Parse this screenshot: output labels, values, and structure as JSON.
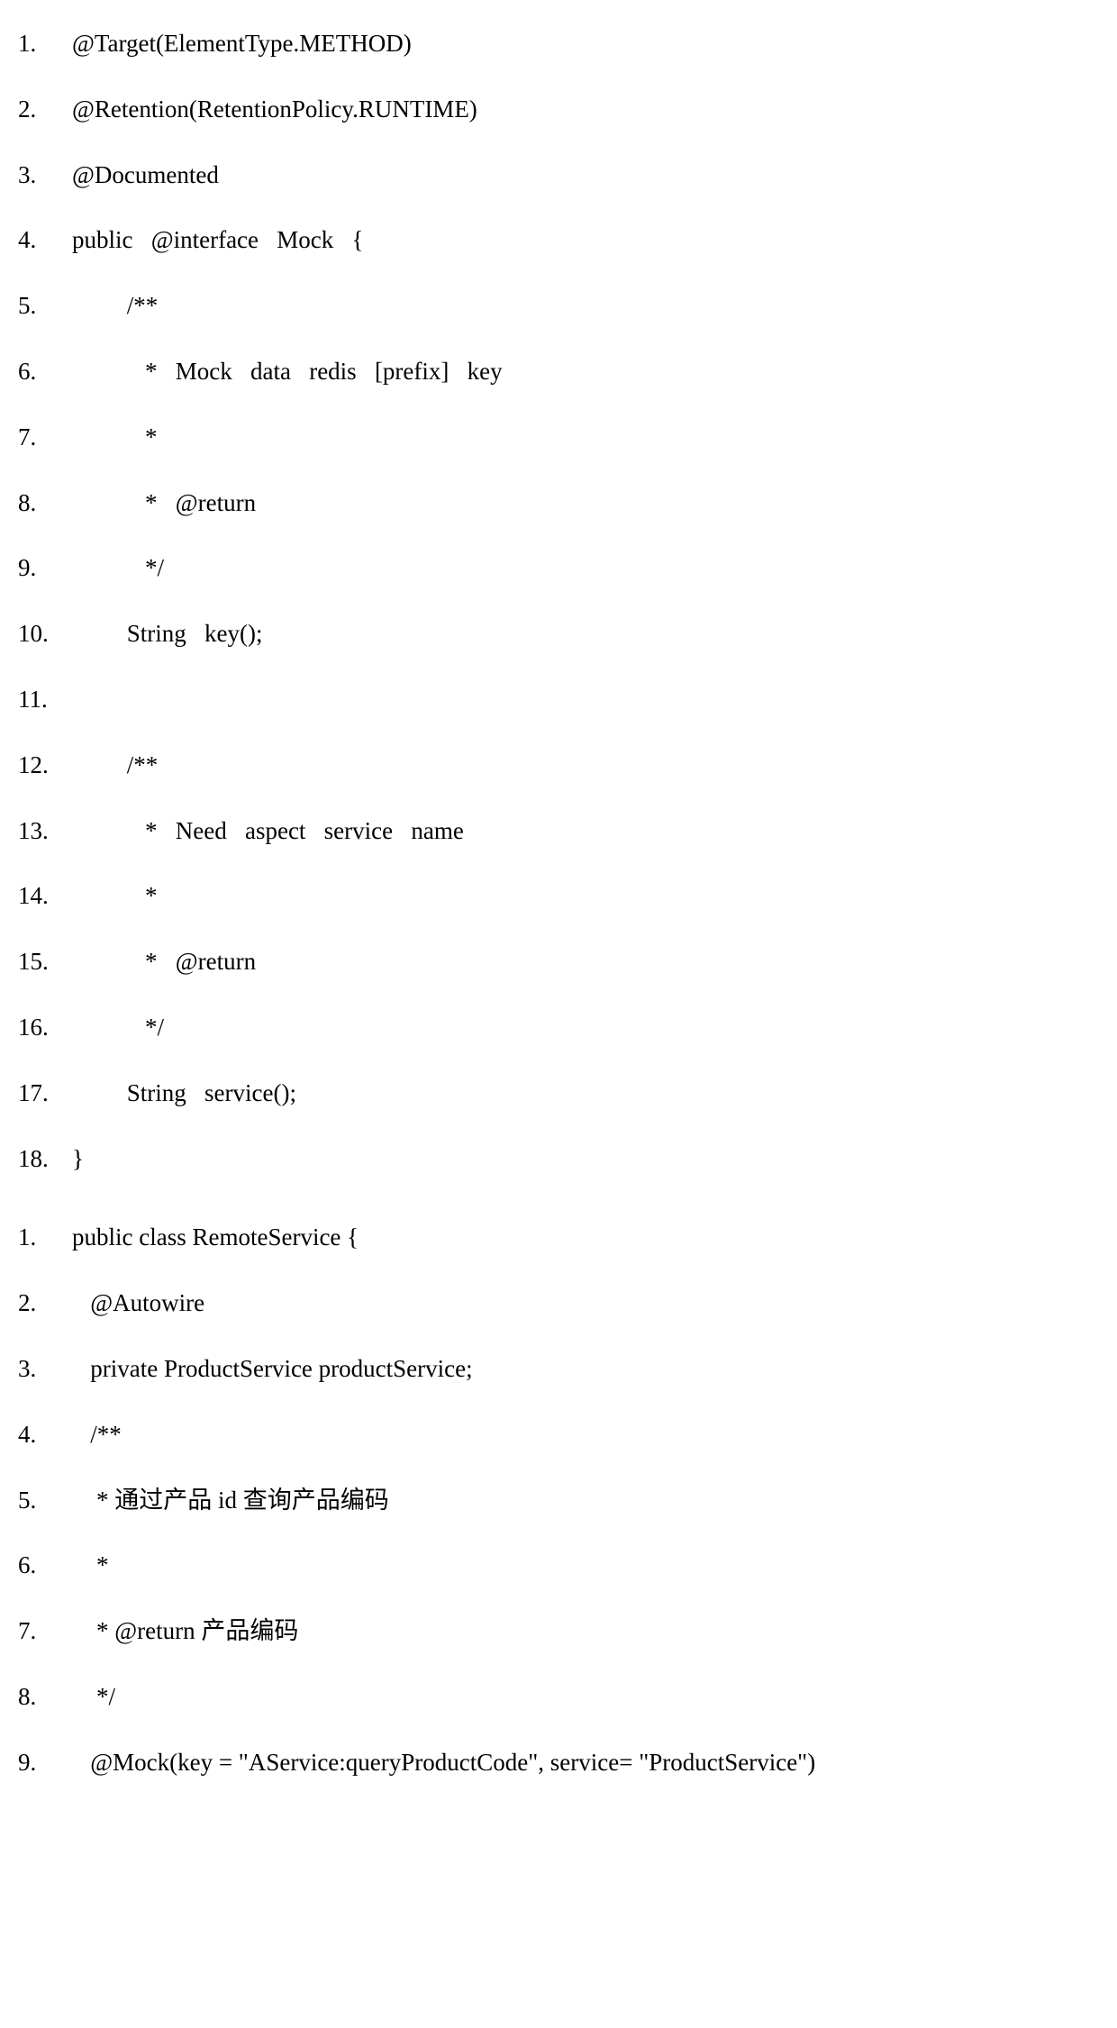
{
  "block1": {
    "lines": [
      {
        "n": "1.",
        "c": "@Target(ElementType.METHOD)"
      },
      {
        "n": "2.",
        "c": "@Retention(RetentionPolicy.RUNTIME)"
      },
      {
        "n": "3.",
        "c": "@Documented"
      },
      {
        "n": "4.",
        "c": "public   @interface   Mock   {"
      },
      {
        "n": "5.",
        "c": "         /**"
      },
      {
        "n": "6.",
        "c": "            *   Mock   data   redis   [prefix]   key"
      },
      {
        "n": "7.",
        "c": "            *"
      },
      {
        "n": "8.",
        "c": "            *   @return"
      },
      {
        "n": "9.",
        "c": "            */"
      },
      {
        "n": "10.",
        "c": "         String   key();"
      },
      {
        "n": "11.",
        "c": ""
      },
      {
        "n": "12.",
        "c": "         /**"
      },
      {
        "n": "13.",
        "c": "            *   Need   aspect   service   name"
      },
      {
        "n": "14.",
        "c": "            *"
      },
      {
        "n": "15.",
        "c": "            *   @return"
      },
      {
        "n": "16.",
        "c": "            */"
      },
      {
        "n": "17.",
        "c": "         String   service();"
      },
      {
        "n": "18.",
        "c": "}"
      }
    ]
  },
  "block2": {
    "lines": [
      {
        "n": "1.",
        "c": "public class RemoteService {"
      },
      {
        "n": "2.",
        "c": "   @Autowire"
      },
      {
        "n": "3.",
        "c": "   private ProductService productService;"
      },
      {
        "n": "4.",
        "c": "   /**"
      },
      {
        "n": "5.",
        "c": "    * 通过产品 id 查询产品编码"
      },
      {
        "n": "6.",
        "c": "    *"
      },
      {
        "n": "7.",
        "c": "    * @return 产品编码"
      },
      {
        "n": "8.",
        "c": "    */"
      },
      {
        "n": "9.",
        "c": "   @Mock(key = \"AService:queryProductCode\", service= \"ProductService\")"
      }
    ]
  }
}
